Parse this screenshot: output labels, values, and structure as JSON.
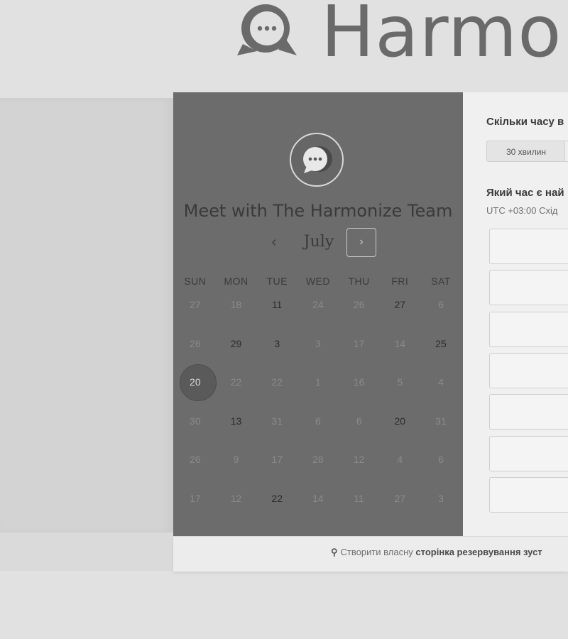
{
  "header": {
    "brand_name": "Harmonize",
    "logo_icon": "chat-bubble-logo"
  },
  "calendar": {
    "title": "Meet with The Harmonize Team",
    "month": "July",
    "prev_label": "‹",
    "next_label": "›",
    "weekdays": [
      "SUN",
      "MON",
      "TUE",
      "WED",
      "THU",
      "FRI",
      "SAT"
    ],
    "weeks": [
      [
        {
          "d": "27",
          "a": false
        },
        {
          "d": "18",
          "a": false
        },
        {
          "d": "11",
          "a": true
        },
        {
          "d": "24",
          "a": false
        },
        {
          "d": "26",
          "a": false
        },
        {
          "d": "27",
          "a": true
        },
        {
          "d": "6",
          "a": false
        }
      ],
      [
        {
          "d": "26",
          "a": false
        },
        {
          "d": "29",
          "a": true
        },
        {
          "d": "3",
          "a": true
        },
        {
          "d": "3",
          "a": false
        },
        {
          "d": "17",
          "a": false
        },
        {
          "d": "14",
          "a": false
        },
        {
          "d": "25",
          "a": true
        }
      ],
      [
        {
          "d": "20",
          "a": true,
          "sel": true
        },
        {
          "d": "22",
          "a": false
        },
        {
          "d": "22",
          "a": false
        },
        {
          "d": "1",
          "a": false
        },
        {
          "d": "16",
          "a": false
        },
        {
          "d": "5",
          "a": false
        },
        {
          "d": "4",
          "a": false
        }
      ],
      [
        {
          "d": "30",
          "a": false
        },
        {
          "d": "13",
          "a": true
        },
        {
          "d": "31",
          "a": false
        },
        {
          "d": "6",
          "a": false
        },
        {
          "d": "6",
          "a": false
        },
        {
          "d": "20",
          "a": true
        },
        {
          "d": "31",
          "a": false
        }
      ],
      [
        {
          "d": "26",
          "a": false
        },
        {
          "d": "9",
          "a": false
        },
        {
          "d": "17",
          "a": false
        },
        {
          "d": "28",
          "a": false
        },
        {
          "d": "12",
          "a": false
        },
        {
          "d": "4",
          "a": false
        },
        {
          "d": "6",
          "a": false
        }
      ],
      [
        {
          "d": "17",
          "a": false
        },
        {
          "d": "12",
          "a": false
        },
        {
          "d": "22",
          "a": true
        },
        {
          "d": "14",
          "a": false
        },
        {
          "d": "11",
          "a": false
        },
        {
          "d": "27",
          "a": false
        },
        {
          "d": "3",
          "a": false
        }
      ]
    ]
  },
  "booking": {
    "duration_question": "Скільки часу в",
    "duration_option": "30 хвилин",
    "time_question": "Який час є най",
    "timezone": "UTC +03:00 Схід"
  },
  "footer": {
    "text_prefix": "Створити власну",
    "text_bold": "сторінка резервування зуст"
  },
  "colors": {
    "calendar_bg": "#6c6c6c",
    "page_bg": "#e1e1e1"
  }
}
